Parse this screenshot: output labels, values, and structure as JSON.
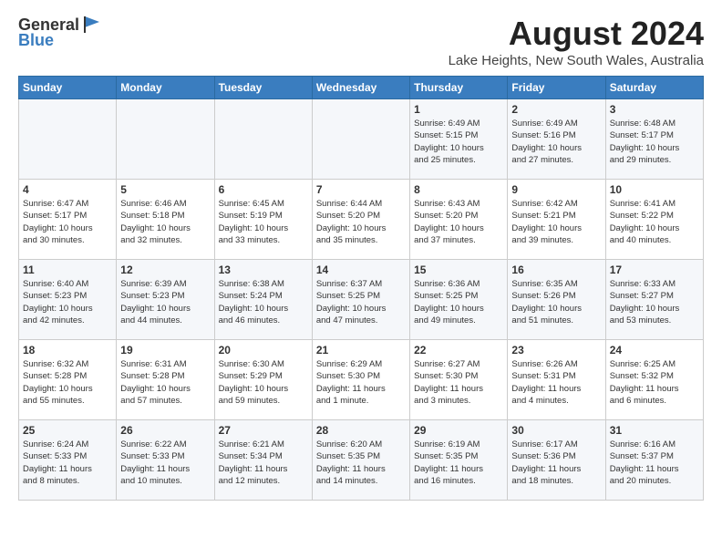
{
  "logo": {
    "general": "General",
    "blue": "Blue"
  },
  "title": "August 2024",
  "location": "Lake Heights, New South Wales, Australia",
  "days_of_week": [
    "Sunday",
    "Monday",
    "Tuesday",
    "Wednesday",
    "Thursday",
    "Friday",
    "Saturday"
  ],
  "weeks": [
    [
      {
        "day": "",
        "info": ""
      },
      {
        "day": "",
        "info": ""
      },
      {
        "day": "",
        "info": ""
      },
      {
        "day": "",
        "info": ""
      },
      {
        "day": "1",
        "info": "Sunrise: 6:49 AM\nSunset: 5:15 PM\nDaylight: 10 hours\nand 25 minutes."
      },
      {
        "day": "2",
        "info": "Sunrise: 6:49 AM\nSunset: 5:16 PM\nDaylight: 10 hours\nand 27 minutes."
      },
      {
        "day": "3",
        "info": "Sunrise: 6:48 AM\nSunset: 5:17 PM\nDaylight: 10 hours\nand 29 minutes."
      }
    ],
    [
      {
        "day": "4",
        "info": "Sunrise: 6:47 AM\nSunset: 5:17 PM\nDaylight: 10 hours\nand 30 minutes."
      },
      {
        "day": "5",
        "info": "Sunrise: 6:46 AM\nSunset: 5:18 PM\nDaylight: 10 hours\nand 32 minutes."
      },
      {
        "day": "6",
        "info": "Sunrise: 6:45 AM\nSunset: 5:19 PM\nDaylight: 10 hours\nand 33 minutes."
      },
      {
        "day": "7",
        "info": "Sunrise: 6:44 AM\nSunset: 5:20 PM\nDaylight: 10 hours\nand 35 minutes."
      },
      {
        "day": "8",
        "info": "Sunrise: 6:43 AM\nSunset: 5:20 PM\nDaylight: 10 hours\nand 37 minutes."
      },
      {
        "day": "9",
        "info": "Sunrise: 6:42 AM\nSunset: 5:21 PM\nDaylight: 10 hours\nand 39 minutes."
      },
      {
        "day": "10",
        "info": "Sunrise: 6:41 AM\nSunset: 5:22 PM\nDaylight: 10 hours\nand 40 minutes."
      }
    ],
    [
      {
        "day": "11",
        "info": "Sunrise: 6:40 AM\nSunset: 5:23 PM\nDaylight: 10 hours\nand 42 minutes."
      },
      {
        "day": "12",
        "info": "Sunrise: 6:39 AM\nSunset: 5:23 PM\nDaylight: 10 hours\nand 44 minutes."
      },
      {
        "day": "13",
        "info": "Sunrise: 6:38 AM\nSunset: 5:24 PM\nDaylight: 10 hours\nand 46 minutes."
      },
      {
        "day": "14",
        "info": "Sunrise: 6:37 AM\nSunset: 5:25 PM\nDaylight: 10 hours\nand 47 minutes."
      },
      {
        "day": "15",
        "info": "Sunrise: 6:36 AM\nSunset: 5:25 PM\nDaylight: 10 hours\nand 49 minutes."
      },
      {
        "day": "16",
        "info": "Sunrise: 6:35 AM\nSunset: 5:26 PM\nDaylight: 10 hours\nand 51 minutes."
      },
      {
        "day": "17",
        "info": "Sunrise: 6:33 AM\nSunset: 5:27 PM\nDaylight: 10 hours\nand 53 minutes."
      }
    ],
    [
      {
        "day": "18",
        "info": "Sunrise: 6:32 AM\nSunset: 5:28 PM\nDaylight: 10 hours\nand 55 minutes."
      },
      {
        "day": "19",
        "info": "Sunrise: 6:31 AM\nSunset: 5:28 PM\nDaylight: 10 hours\nand 57 minutes."
      },
      {
        "day": "20",
        "info": "Sunrise: 6:30 AM\nSunset: 5:29 PM\nDaylight: 10 hours\nand 59 minutes."
      },
      {
        "day": "21",
        "info": "Sunrise: 6:29 AM\nSunset: 5:30 PM\nDaylight: 11 hours\nand 1 minute."
      },
      {
        "day": "22",
        "info": "Sunrise: 6:27 AM\nSunset: 5:30 PM\nDaylight: 11 hours\nand 3 minutes."
      },
      {
        "day": "23",
        "info": "Sunrise: 6:26 AM\nSunset: 5:31 PM\nDaylight: 11 hours\nand 4 minutes."
      },
      {
        "day": "24",
        "info": "Sunrise: 6:25 AM\nSunset: 5:32 PM\nDaylight: 11 hours\nand 6 minutes."
      }
    ],
    [
      {
        "day": "25",
        "info": "Sunrise: 6:24 AM\nSunset: 5:33 PM\nDaylight: 11 hours\nand 8 minutes."
      },
      {
        "day": "26",
        "info": "Sunrise: 6:22 AM\nSunset: 5:33 PM\nDaylight: 11 hours\nand 10 minutes."
      },
      {
        "day": "27",
        "info": "Sunrise: 6:21 AM\nSunset: 5:34 PM\nDaylight: 11 hours\nand 12 minutes."
      },
      {
        "day": "28",
        "info": "Sunrise: 6:20 AM\nSunset: 5:35 PM\nDaylight: 11 hours\nand 14 minutes."
      },
      {
        "day": "29",
        "info": "Sunrise: 6:19 AM\nSunset: 5:35 PM\nDaylight: 11 hours\nand 16 minutes."
      },
      {
        "day": "30",
        "info": "Sunrise: 6:17 AM\nSunset: 5:36 PM\nDaylight: 11 hours\nand 18 minutes."
      },
      {
        "day": "31",
        "info": "Sunrise: 6:16 AM\nSunset: 5:37 PM\nDaylight: 11 hours\nand 20 minutes."
      }
    ]
  ]
}
